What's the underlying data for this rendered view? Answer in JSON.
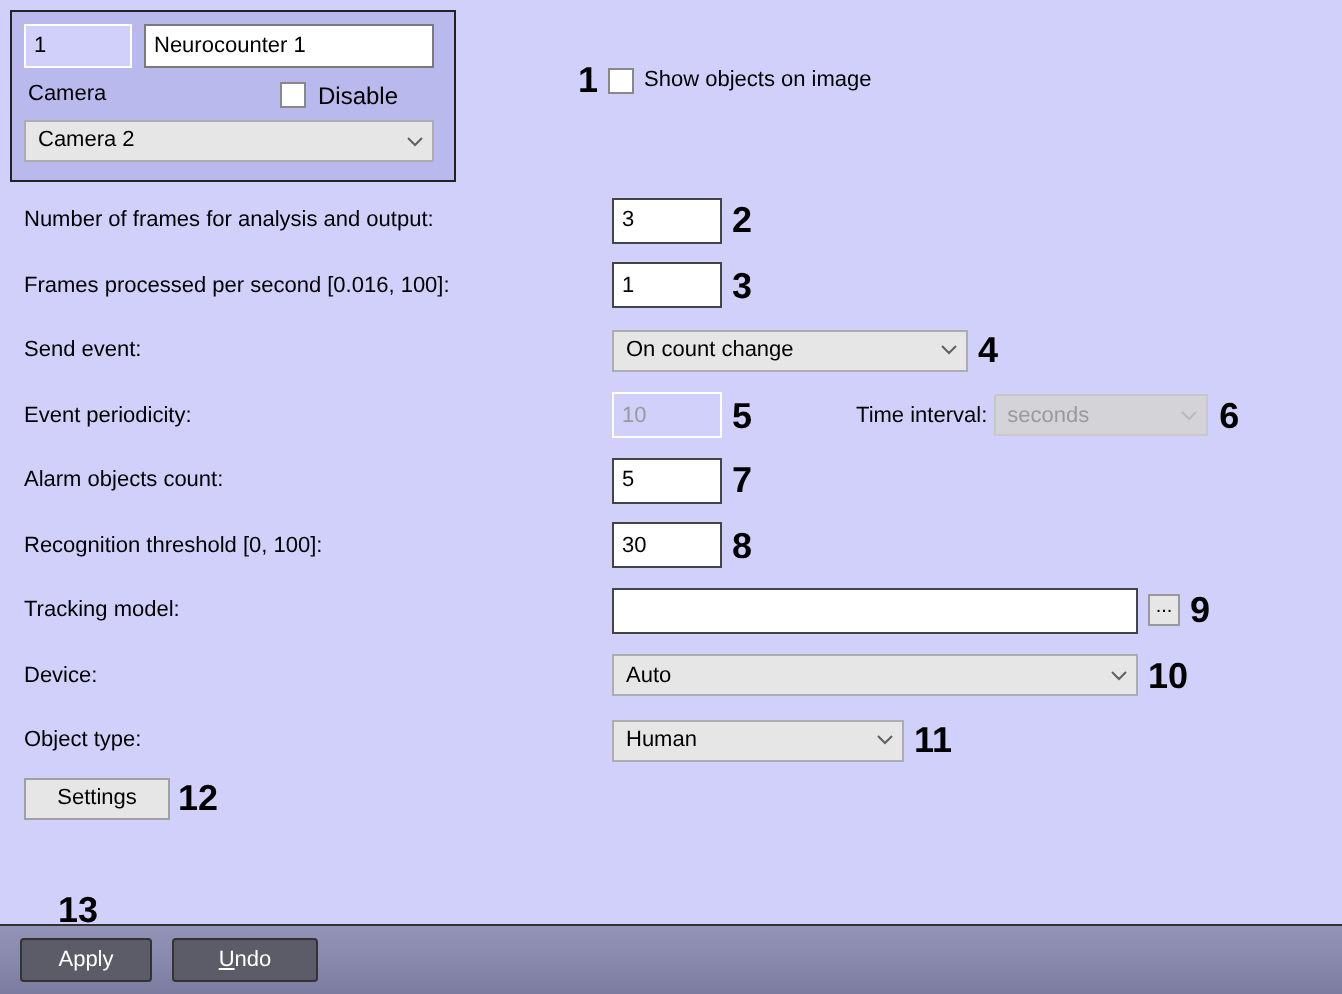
{
  "header": {
    "id_field": "1",
    "name_field": "Neurocounter 1",
    "camera_label": "Camera",
    "disable": {
      "label": "Disable",
      "checked": false
    },
    "camera_select": "Camera 2"
  },
  "show_objects": {
    "callout": "1",
    "label": "Show objects on image",
    "checked": false
  },
  "rows": [
    {
      "label": "Number of frames for analysis and output:",
      "kind": "input",
      "value": "3",
      "disabled": false,
      "callout": "2"
    },
    {
      "label": "Frames processed per second [0.016, 100]:",
      "kind": "input",
      "value": "1",
      "disabled": false,
      "callout": "3"
    },
    {
      "label": "Send event:",
      "kind": "select",
      "value": "On count change",
      "disabled": false,
      "callout": "4"
    },
    {
      "label": "Event periodicity:",
      "kind": "input",
      "value": "10",
      "disabled": true,
      "callout": "5",
      "extra": {
        "label": "Time interval:",
        "value": "seconds",
        "disabled": true,
        "callout": "6"
      }
    },
    {
      "label": "Alarm objects count:",
      "kind": "input",
      "value": "5",
      "disabled": false,
      "callout": "7"
    },
    {
      "label": "Recognition threshold [0, 100]:",
      "kind": "input",
      "value": "30",
      "disabled": false,
      "callout": "8"
    },
    {
      "label": "Tracking model:",
      "kind": "browse",
      "button": "...",
      "disabled": false,
      "callout": "9"
    },
    {
      "label": "Device:",
      "kind": "select_wide",
      "value": "Auto",
      "disabled": false,
      "callout": "10"
    },
    {
      "label": "Object type:",
      "kind": "select_mid",
      "value": "Human",
      "disabled": false,
      "callout": "11"
    }
  ],
  "settings": {
    "label": "Settings",
    "callout": "12"
  },
  "footer": {
    "callout": "13",
    "buttons": [
      "Apply",
      "Undo"
    ]
  }
}
